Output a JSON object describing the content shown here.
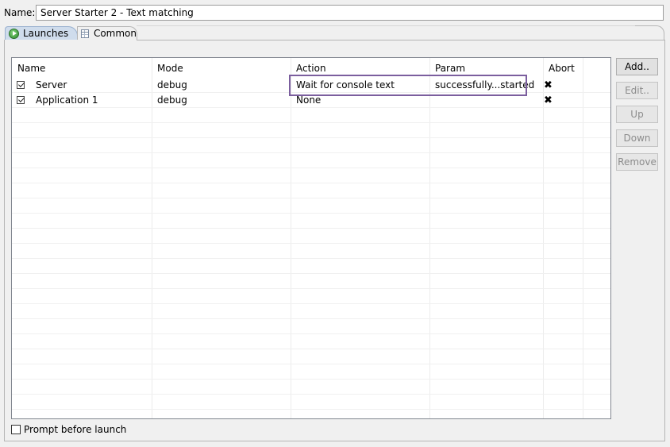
{
  "config": {
    "name_label": "Name:",
    "name_value": "Server Starter 2 - Text matching"
  },
  "tabs": [
    {
      "label": "Launches",
      "icon": "play-icon",
      "active": true
    },
    {
      "label": "Common",
      "icon": "table-icon",
      "active": false
    }
  ],
  "table": {
    "columns": [
      "Name",
      "Mode",
      "Action",
      "Param",
      "Abort"
    ],
    "rows": [
      {
        "checked": true,
        "name": "Server",
        "mode": "debug",
        "action": "Wait for console text",
        "param": "successfully...started",
        "abort": "✖"
      },
      {
        "checked": true,
        "name": "Application 1",
        "mode": "debug",
        "action": "None",
        "param": "",
        "abort": "✖"
      }
    ]
  },
  "buttons": {
    "add": "Add..",
    "edit": "Edit..",
    "up": "Up",
    "down": "Down",
    "remove": "Remove"
  },
  "prompt_before_launch": {
    "label": "Prompt before launch",
    "checked": false
  },
  "colors": {
    "active_tab": "#cfdcec",
    "edit_highlight": "#7b5e9e"
  }
}
